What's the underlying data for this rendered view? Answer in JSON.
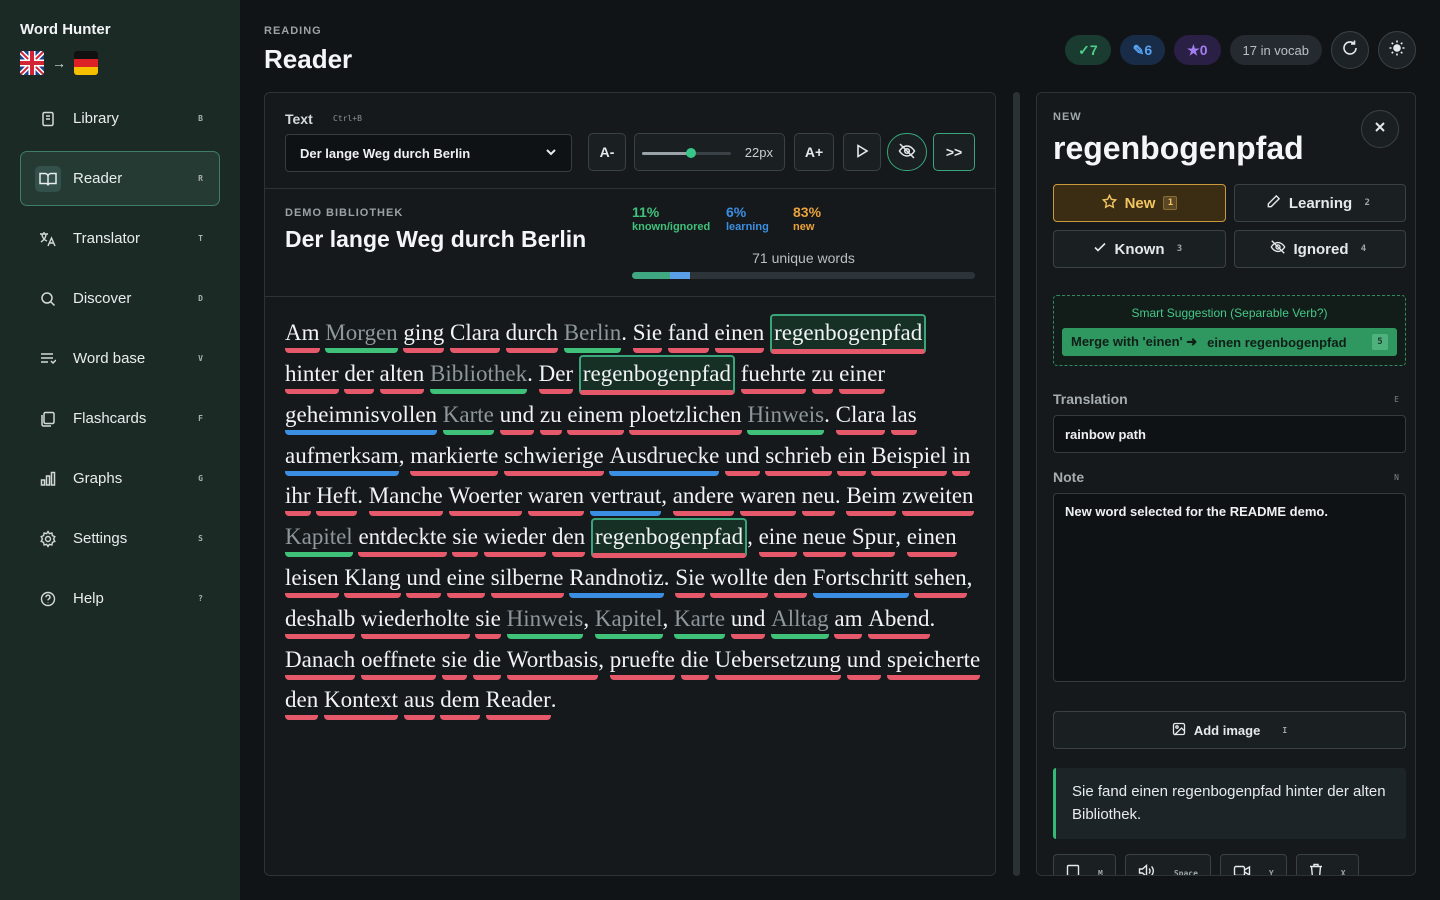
{
  "app": {
    "title": "Word Hunter",
    "arrow": "→"
  },
  "sidebar": {
    "items": [
      {
        "label": "Library",
        "key": "B",
        "icon": "book-icon"
      },
      {
        "label": "Reader",
        "key": "R",
        "icon": "open-book-icon",
        "active": true
      },
      {
        "label": "Translator",
        "key": "T",
        "icon": "translate-icon"
      },
      {
        "label": "Discover",
        "key": "D",
        "icon": "search-icon"
      },
      {
        "label": "Word base",
        "key": "V",
        "icon": "list-icon"
      },
      {
        "label": "Flashcards",
        "key": "F",
        "icon": "cards-icon"
      },
      {
        "label": "Graphs",
        "key": "G",
        "icon": "bar-chart-icon"
      },
      {
        "label": "Settings",
        "key": "S",
        "icon": "gear-icon"
      },
      {
        "label": "Help",
        "key": "?",
        "icon": "help-icon"
      }
    ]
  },
  "header": {
    "section": "READING",
    "title": "Reader",
    "known_count": "✓7",
    "learning_count": "✎6",
    "starred_count": "★0",
    "vocab": "17 in vocab"
  },
  "toolbar": {
    "text_label": "Text",
    "text_kbd": "Ctrl+B",
    "selected_text": "Der lange Weg durch Berlin",
    "decrease": "A-",
    "increase": "A+",
    "font_size": "22px",
    "font_size_level": 0.55,
    "next": ">>"
  },
  "meta": {
    "library": "DEMO BIBLIOTHEK",
    "title": "Der lange Weg durch Berlin",
    "known_pct": "11%",
    "known_label": "known/ignored",
    "learning_pct": "6%",
    "learning_label": "learning",
    "new_pct": "83%",
    "new_label": "new",
    "unique": "71 unique words",
    "progress": {
      "known": 11,
      "learning": 6,
      "new": 83
    }
  },
  "reading": {
    "tokens": [
      [
        "Am",
        "n"
      ],
      [
        " ",
        ""
      ],
      [
        "Morgen",
        "k"
      ],
      [
        " ",
        ""
      ],
      [
        "ging",
        "n"
      ],
      [
        " ",
        ""
      ],
      [
        "Clara",
        "n"
      ],
      [
        " ",
        ""
      ],
      [
        "durch",
        "n"
      ],
      [
        " ",
        ""
      ],
      [
        "Berlin",
        "k"
      ],
      [
        ". ",
        ""
      ],
      [
        "Sie",
        "n"
      ],
      [
        " ",
        ""
      ],
      [
        "fand",
        "n"
      ],
      [
        " ",
        ""
      ],
      [
        "einen",
        "n"
      ],
      [
        " ",
        ""
      ],
      [
        "regenbogenpfad",
        "s"
      ],
      [
        " ",
        ""
      ],
      [
        "hinter",
        "n"
      ],
      [
        " ",
        ""
      ],
      [
        "der",
        "n"
      ],
      [
        " ",
        ""
      ],
      [
        "alten",
        "n"
      ],
      [
        " ",
        ""
      ],
      [
        "Bibliothek",
        "k"
      ],
      [
        ". ",
        ""
      ],
      [
        "Der",
        "n"
      ],
      [
        " ",
        ""
      ],
      [
        "regenbogenpfad",
        "s"
      ],
      [
        " ",
        ""
      ],
      [
        "fuehrte",
        "n"
      ],
      [
        " ",
        ""
      ],
      [
        "zu",
        "n"
      ],
      [
        " ",
        ""
      ],
      [
        "einer",
        "n"
      ],
      [
        " ",
        ""
      ],
      [
        "geheimnisvollen",
        "l"
      ],
      [
        " ",
        ""
      ],
      [
        "Karte",
        "k"
      ],
      [
        " ",
        ""
      ],
      [
        "und",
        "n"
      ],
      [
        " ",
        ""
      ],
      [
        "zu",
        "n"
      ],
      [
        " ",
        ""
      ],
      [
        "einem",
        "n"
      ],
      [
        " ",
        ""
      ],
      [
        "ploetzlichen",
        "n"
      ],
      [
        " ",
        ""
      ],
      [
        "Hinweis",
        "k"
      ],
      [
        ". ",
        ""
      ],
      [
        "Clara",
        "n"
      ],
      [
        " ",
        ""
      ],
      [
        "las",
        "n"
      ],
      [
        " ",
        ""
      ],
      [
        "aufmerksam",
        "l"
      ],
      [
        ", ",
        ""
      ],
      [
        "markierte",
        "n"
      ],
      [
        " ",
        ""
      ],
      [
        "schwierige",
        "n"
      ],
      [
        " ",
        ""
      ],
      [
        "Ausdruecke",
        "l"
      ],
      [
        " ",
        ""
      ],
      [
        "und",
        "n"
      ],
      [
        " ",
        ""
      ],
      [
        "schrieb",
        "n"
      ],
      [
        " ",
        ""
      ],
      [
        "ein",
        "n"
      ],
      [
        " ",
        ""
      ],
      [
        "Beispiel",
        "n"
      ],
      [
        " ",
        ""
      ],
      [
        "in",
        "n"
      ],
      [
        " ",
        ""
      ],
      [
        "ihr",
        "n"
      ],
      [
        " ",
        ""
      ],
      [
        "Heft",
        "n"
      ],
      [
        ". ",
        ""
      ],
      [
        "Manche",
        "n"
      ],
      [
        " ",
        ""
      ],
      [
        "Woerter",
        "n"
      ],
      [
        " ",
        ""
      ],
      [
        "waren",
        "n"
      ],
      [
        " ",
        ""
      ],
      [
        "vertraut",
        "l"
      ],
      [
        ", ",
        ""
      ],
      [
        "andere",
        "n"
      ],
      [
        " ",
        ""
      ],
      [
        "waren",
        "n"
      ],
      [
        " ",
        ""
      ],
      [
        "neu",
        "n"
      ],
      [
        ". ",
        ""
      ],
      [
        "Beim",
        "n"
      ],
      [
        " ",
        ""
      ],
      [
        "zweiten",
        "n"
      ],
      [
        " ",
        ""
      ],
      [
        "Kapitel",
        "k"
      ],
      [
        " ",
        ""
      ],
      [
        "entdeckte",
        "n"
      ],
      [
        " ",
        ""
      ],
      [
        "sie",
        "n"
      ],
      [
        " ",
        ""
      ],
      [
        "wieder",
        "n"
      ],
      [
        " ",
        ""
      ],
      [
        "den",
        "n"
      ],
      [
        " ",
        ""
      ],
      [
        "regenbogenpfad",
        "s"
      ],
      [
        ", ",
        ""
      ],
      [
        "eine",
        "n"
      ],
      [
        " ",
        ""
      ],
      [
        "neue",
        "n"
      ],
      [
        " ",
        ""
      ],
      [
        "Spur",
        "n"
      ],
      [
        ", ",
        ""
      ],
      [
        "einen",
        "n"
      ],
      [
        " ",
        ""
      ],
      [
        "leisen",
        "n"
      ],
      [
        " ",
        ""
      ],
      [
        "Klang",
        "n"
      ],
      [
        " ",
        ""
      ],
      [
        "und",
        "n"
      ],
      [
        " ",
        ""
      ],
      [
        "eine",
        "n"
      ],
      [
        " ",
        ""
      ],
      [
        "silberne",
        "n"
      ],
      [
        " ",
        ""
      ],
      [
        "Randnotiz",
        "l"
      ],
      [
        ". ",
        ""
      ],
      [
        "Sie",
        "n"
      ],
      [
        " ",
        ""
      ],
      [
        "wollte",
        "n"
      ],
      [
        " ",
        ""
      ],
      [
        "den",
        "n"
      ],
      [
        " ",
        ""
      ],
      [
        "Fortschritt",
        "l"
      ],
      [
        " ",
        ""
      ],
      [
        "sehen",
        "n"
      ],
      [
        ", ",
        ""
      ],
      [
        "deshalb",
        "n"
      ],
      [
        " ",
        ""
      ],
      [
        "wiederholte",
        "n"
      ],
      [
        " ",
        ""
      ],
      [
        "sie",
        "n"
      ],
      [
        " ",
        ""
      ],
      [
        "Hinweis",
        "k"
      ],
      [
        ", ",
        ""
      ],
      [
        "Kapitel",
        "k"
      ],
      [
        ", ",
        ""
      ],
      [
        "Karte",
        "k"
      ],
      [
        " ",
        ""
      ],
      [
        "und",
        "n"
      ],
      [
        " ",
        ""
      ],
      [
        "Alltag",
        "k"
      ],
      [
        " ",
        ""
      ],
      [
        "am",
        "n"
      ],
      [
        " ",
        ""
      ],
      [
        "Abend",
        "n"
      ],
      [
        ". ",
        ""
      ],
      [
        "Danach",
        "n"
      ],
      [
        " ",
        ""
      ],
      [
        "oeffnete",
        "n"
      ],
      [
        " ",
        ""
      ],
      [
        "sie",
        "n"
      ],
      [
        " ",
        ""
      ],
      [
        "die",
        "n"
      ],
      [
        " ",
        ""
      ],
      [
        "Wortbasis",
        "n"
      ],
      [
        ", ",
        ""
      ],
      [
        "pruefte",
        "n"
      ],
      [
        " ",
        ""
      ],
      [
        "die",
        "n"
      ],
      [
        " ",
        ""
      ],
      [
        "Uebersetzung",
        "n"
      ],
      [
        " ",
        ""
      ],
      [
        "und",
        "n"
      ],
      [
        " ",
        ""
      ],
      [
        "speicherte",
        "n"
      ],
      [
        " ",
        ""
      ],
      [
        "den",
        "n"
      ],
      [
        " ",
        ""
      ],
      [
        "Kontext",
        "n"
      ],
      [
        " ",
        ""
      ],
      [
        "aus",
        "n"
      ],
      [
        " ",
        ""
      ],
      [
        "dem",
        "n"
      ],
      [
        " ",
        ""
      ],
      [
        "Reader",
        "n"
      ],
      [
        ".",
        ""
      ]
    ]
  },
  "word_panel": {
    "status": "NEW",
    "word": "regenbogenpfad",
    "buttons": [
      {
        "label": "New",
        "key": "1",
        "icon": "star-icon",
        "active": true
      },
      {
        "label": "Learning",
        "key": "2",
        "icon": "pencil-icon"
      },
      {
        "label": "Known",
        "key": "3",
        "icon": "check-icon"
      },
      {
        "label": "Ignored",
        "key": "4",
        "icon": "eye-off-icon"
      }
    ],
    "smart_title": "Smart Suggestion (Separable Verb?)",
    "merge_label": "Merge with 'einen' ➜",
    "merge_result": "einen regenbogenpfad",
    "merge_key": "5",
    "translation_label": "Translation",
    "translation_key": "E",
    "translation": "rainbow path",
    "note_label": "Note",
    "note_key": "N",
    "note": "New word selected for the README demo.",
    "add_image": "Add image",
    "add_image_key": "I",
    "context": "Sie fand einen regenbogenpfad hinter der alten Bibliothek.",
    "actions": [
      {
        "icon": "checkbox-icon",
        "key": "M"
      },
      {
        "icon": "speaker-icon",
        "key": "Space"
      },
      {
        "icon": "video-icon",
        "key": "Y"
      },
      {
        "icon": "trash-icon",
        "key": "X"
      }
    ]
  },
  "colors": {
    "accent": "#37c889",
    "new": "#e5596a",
    "learning": "#3b8fe3",
    "known": "#3fc17a",
    "star": "#f2c560"
  }
}
